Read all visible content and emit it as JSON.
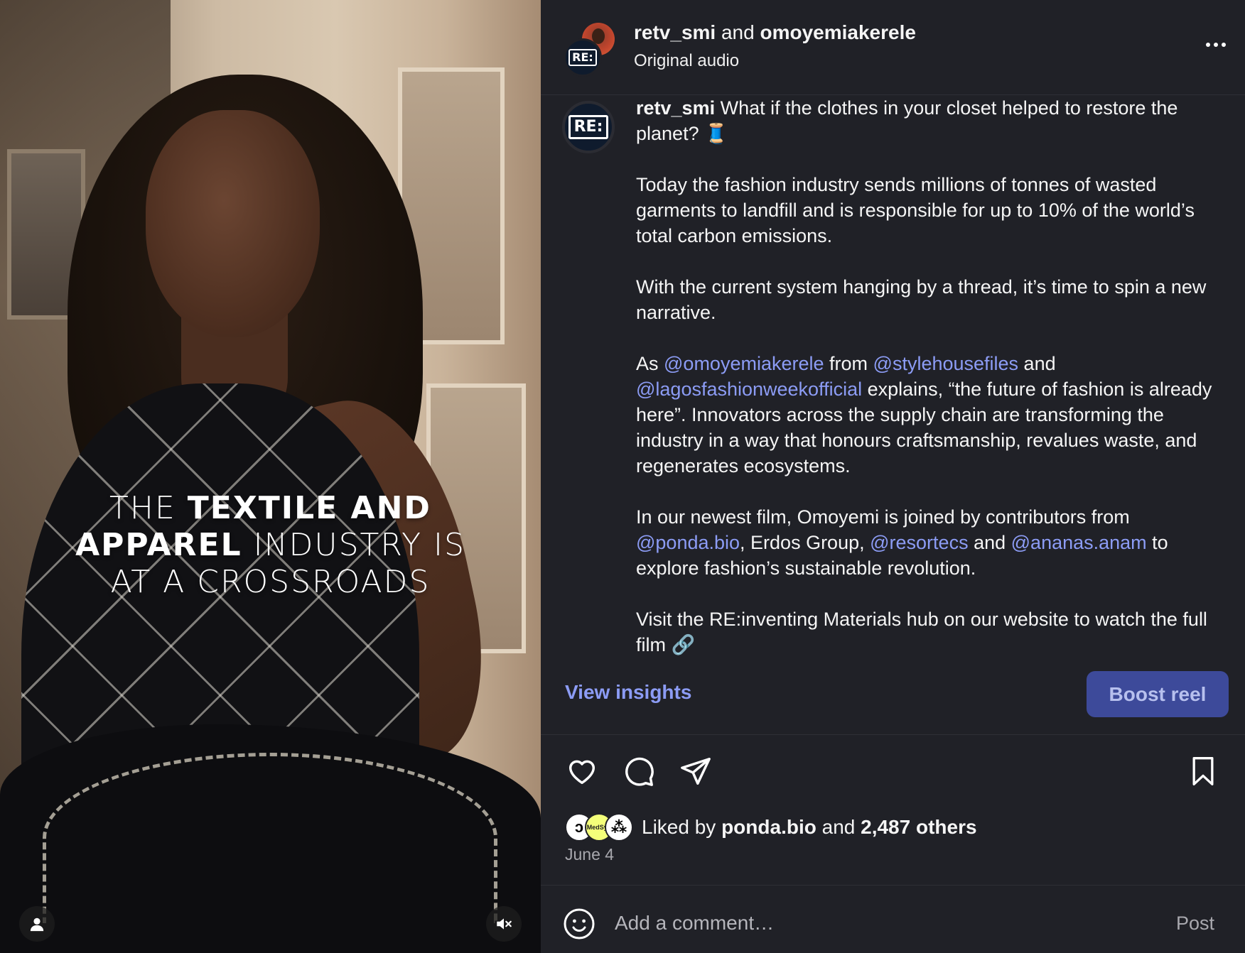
{
  "video": {
    "overlay": {
      "line1_light": "THE ",
      "line1_bold": "TEXTILE AND",
      "line2_bold": "APPAREL",
      "line2_light": " INDUSTRY IS",
      "line3_light": "AT A CROSSROADS"
    },
    "icons": {
      "user": "user-icon",
      "mute": "muted-speaker-icon"
    }
  },
  "header": {
    "user1": "retv_smi",
    "joiner": " and ",
    "user2": "omoyemiakerele",
    "audio": "Original audio",
    "logo_text": "RE:"
  },
  "caption": {
    "user": "retv_smi",
    "p1_text": " What if the clothes in your closet helped to restore the planet? 🧵",
    "p2": "Today the fashion industry sends millions of tonnes of wasted garments to landfill and is responsible for up to 10% of the world’s total carbon emissions.",
    "p3": "With the current system hanging by a thread, it’s time to spin a new narrative.",
    "p4_a": "As ",
    "p4_m1": "@omoyemiakerele",
    "p4_b": " from ",
    "p4_m2": "@stylehousefiles",
    "p4_c": " and ",
    "p4_m3": "@lagosfashionweekofficial",
    "p4_d": " explains, “the future of fashion is already here”. Innovators across the supply chain are transforming the industry in a way that honours craftsmanship, revalues waste, and regenerates ecosystems.",
    "p5_a": "In our newest film, Omoyemi is joined by contributors from ",
    "p5_m1": "@ponda.bio",
    "p5_b": ", Erdos Group, ",
    "p5_m2": "@resortecs",
    "p5_c": " and ",
    "p5_m3": "@ananas.anam",
    "p5_d": " to explore fashion’s sustainable revolution.",
    "p6": "Visit the RE:inventing Materials hub on our website to watch the full film 🔗"
  },
  "insights": {
    "view_label": "View insights",
    "boost_label": "Boost reel"
  },
  "actions": {
    "icons": [
      "heart-icon",
      "comment-icon",
      "share-icon",
      "bookmark-icon"
    ]
  },
  "likes": {
    "prefix": "Liked by ",
    "user": "ponda.bio",
    "joiner": " and ",
    "others": "2,487 others",
    "avatar2_text": "MedSyn",
    "date": "June 4"
  },
  "comment": {
    "placeholder": "Add a comment…",
    "post_label": "Post"
  },
  "colors": {
    "panel_bg": "#202127",
    "mention": "#8c9cf5",
    "boost_bg": "#3d4a9a"
  }
}
